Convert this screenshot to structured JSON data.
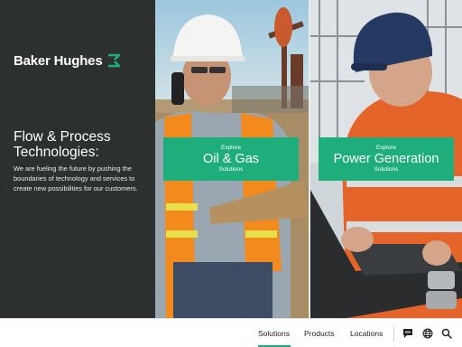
{
  "brand": {
    "name": "Baker Hughes",
    "accent_color": "#1eae7c"
  },
  "hero": {
    "headline_line1": "Flow & Process",
    "headline_line2": "Technologies:",
    "description": "We are fueling the future by pushing the boundaries of technology and services to create new possibilities for our customers."
  },
  "cards": [
    {
      "eyebrow": "Explore",
      "title": "Oil & Gas",
      "subtitle": "Solutions"
    },
    {
      "eyebrow": "Explore",
      "title": "Power Generation",
      "subtitle": "Solutions"
    }
  ],
  "nav": {
    "items": [
      {
        "label": "Solutions",
        "active": true
      },
      {
        "label": "Products",
        "active": false
      },
      {
        "label": "Locations",
        "active": false
      }
    ],
    "icons": [
      "chat-icon",
      "globe-icon",
      "search-icon"
    ]
  }
}
